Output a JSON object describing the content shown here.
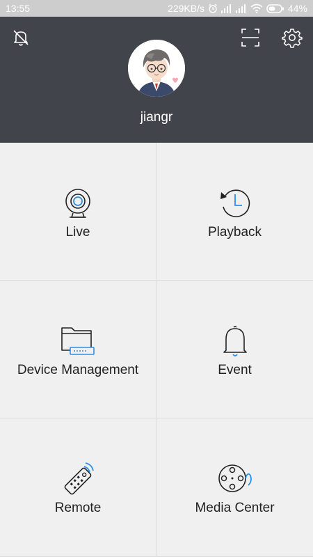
{
  "status_bar": {
    "time": "13:55",
    "speed": "229KB/s",
    "battery": "44%"
  },
  "header": {
    "username": "jiangr"
  },
  "menu": {
    "items": [
      {
        "label": "Live",
        "icon": "webcam-icon"
      },
      {
        "label": "Playback",
        "icon": "history-clock-icon"
      },
      {
        "label": "Device Management",
        "icon": "folder-device-icon"
      },
      {
        "label": "Event",
        "icon": "bell-icon"
      },
      {
        "label": "Remote",
        "icon": "remote-control-icon"
      },
      {
        "label": "Media Center",
        "icon": "film-reel-icon"
      }
    ]
  },
  "colors": {
    "header_bg": "#41444b",
    "status_bg": "#cdcdcd",
    "accent_blue": "#2b8fe6",
    "grid_bg": "#f0f0f0"
  }
}
